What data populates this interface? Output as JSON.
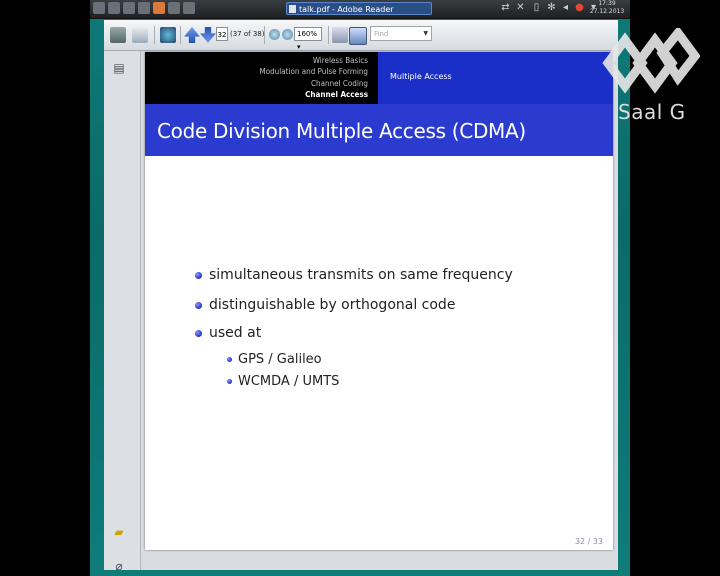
{
  "taskbar": {
    "task_title": "talk.pdf - Adobe Reader",
    "clock_time": "17:39",
    "clock_date": "27.12.2013"
  },
  "toolbar": {
    "page_input": "32",
    "page_count": "(37 of 38)",
    "zoom": "160%",
    "find_placeholder": "Find"
  },
  "slide": {
    "nav_sections": [
      "Wireless Basics",
      "Modulation and Pulse Forming",
      "Channel Coding",
      "Channel Access"
    ],
    "active_section": "Channel Access",
    "subsection": "Multiple Access",
    "title": "Code Division Multiple Access (CDMA)",
    "bullets": [
      "simultaneous transmits on same frequency",
      "distinguishable by orthogonal code",
      "used at"
    ],
    "sub_bullets": [
      "GPS / Galileo",
      "WCMDA / UMTS"
    ],
    "page_number": "32 / 33"
  },
  "watermark": {
    "text": "Saal G"
  },
  "colors": {
    "slide_blue": "#2b3bcf",
    "desktop_teal": "#0f7a78"
  }
}
